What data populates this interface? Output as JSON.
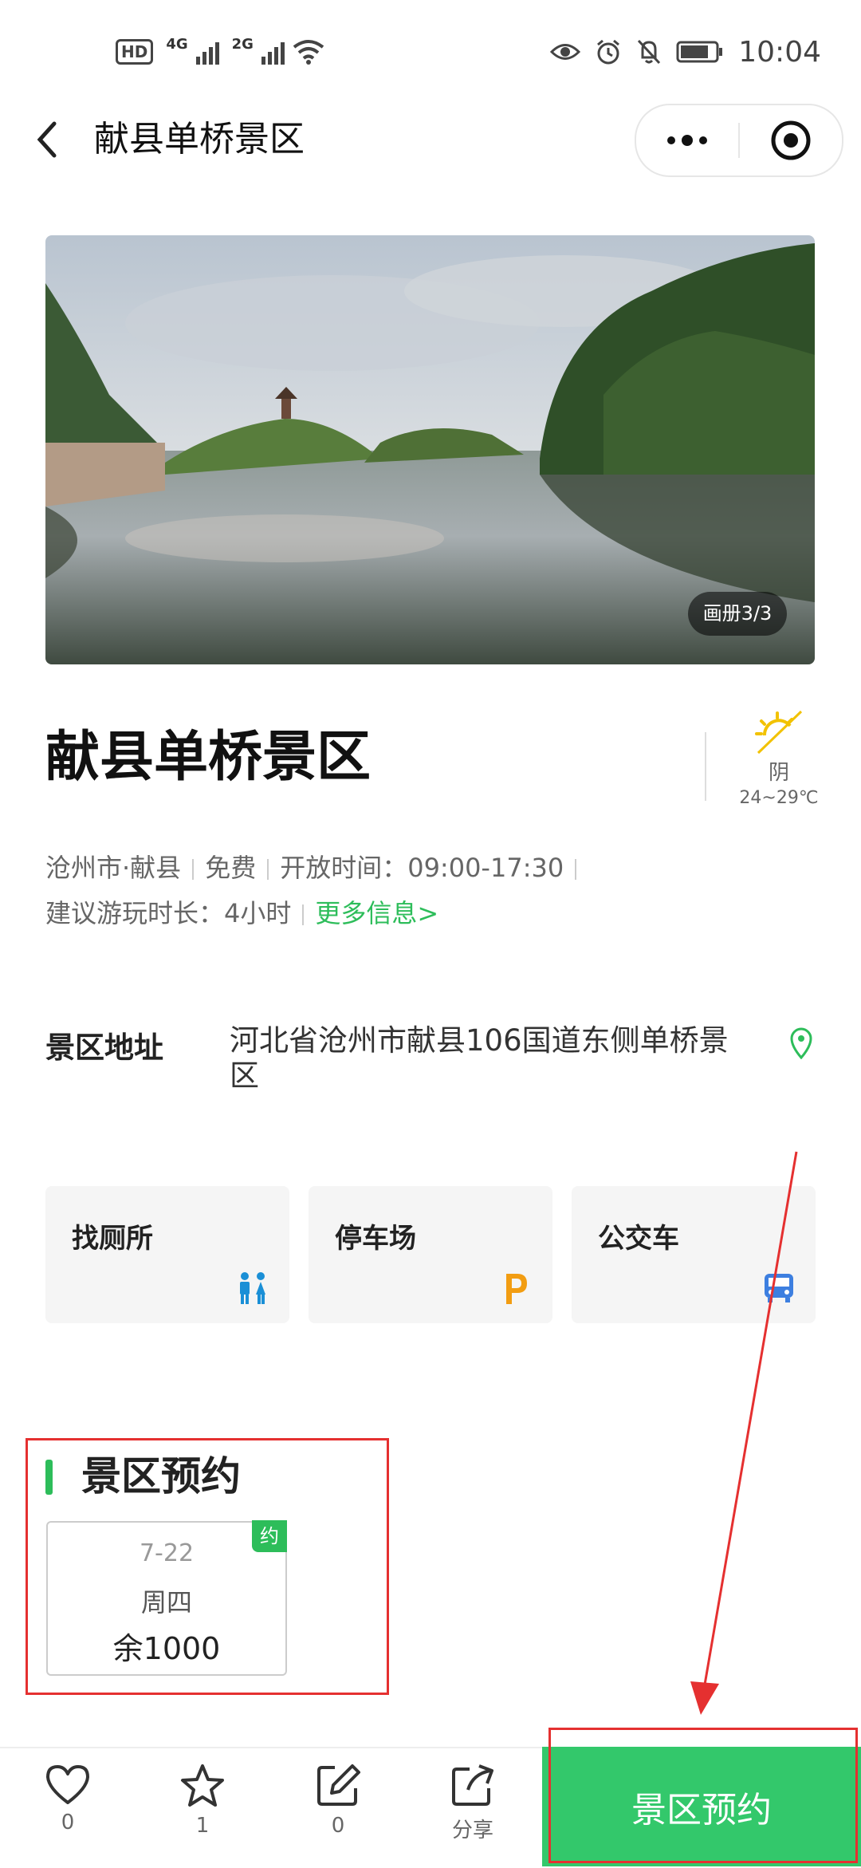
{
  "status_bar": {
    "hd": "HD",
    "net1": "4G",
    "net2": "2G",
    "time": "10:04"
  },
  "nav": {
    "title": "献县单桥景区"
  },
  "gallery": {
    "counter": "画册3/3"
  },
  "attraction": {
    "name": "献县单桥景区",
    "weather": {
      "condition": "阴",
      "temperature": "24~29℃"
    },
    "location": "沧州市·献县",
    "price": "免费",
    "hours": "开放时间：09:00-17:30",
    "duration": "建议游玩时长：4小时",
    "more_link": "更多信息>"
  },
  "address": {
    "label": "景区地址",
    "value": "河北省沧州市献县106国道东侧单桥景区"
  },
  "facilities": [
    {
      "label": "找厕所",
      "icon": "restroom-icon",
      "color": "#1a8fd6"
    },
    {
      "label": "停车场",
      "icon": "parking-icon",
      "color": "#f29d12"
    },
    {
      "label": "公交车",
      "icon": "bus-icon",
      "color": "#3d7fe0"
    }
  ],
  "reservation": {
    "title": "景区预约",
    "tag": "约",
    "date": "7-22",
    "weekday": "周四",
    "remaining": "余1000"
  },
  "bottom_bar": {
    "like_count": "0",
    "favorite_count": "1",
    "comment_count": "0",
    "share_label": "分享",
    "book_button": "景区预约"
  },
  "colors": {
    "accent_green": "#2dbd5a",
    "button_green": "#33c86b",
    "annotation_red": "#e53030"
  }
}
